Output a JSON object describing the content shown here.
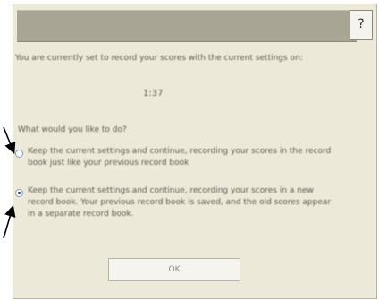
{
  "dialog": {
    "help_label": "?",
    "message": "You are currently set to record your scores with the current settings on:",
    "value": "1:37",
    "question": "What would you like to do?",
    "options": [
      {
        "label": "Keep the current settings and continue, recording your scores in the record book just like your previous record book",
        "selected": false
      },
      {
        "label": "Keep the current settings and continue, recording your scores in a new record book. Your previous record book is saved, and the old scores appear in a separate record book.",
        "selected": true
      }
    ],
    "ok_label": "OK"
  }
}
